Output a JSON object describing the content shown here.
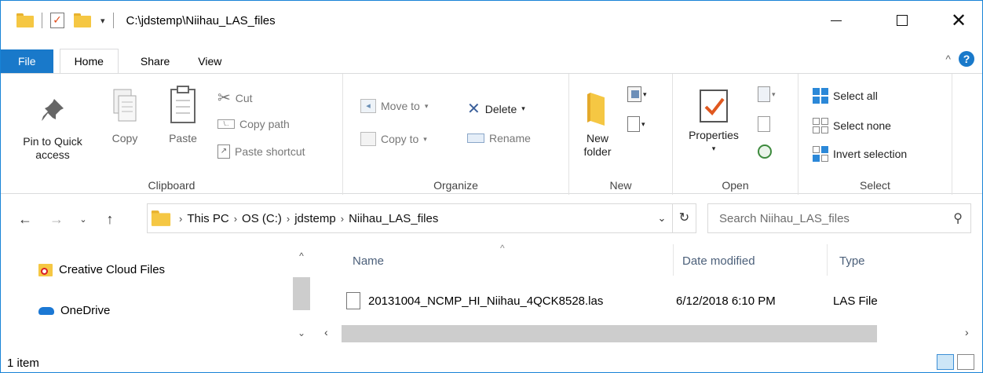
{
  "window": {
    "title": "C:\\jdstemp\\Niihau_LAS_files",
    "controls": {
      "minimize": "minimize",
      "maximize": "maximize",
      "close": "close"
    }
  },
  "quick_access": {
    "dropdown": "▾"
  },
  "tabs": [
    {
      "label": "File"
    },
    {
      "label": "Home"
    },
    {
      "label": "Share"
    },
    {
      "label": "View"
    }
  ],
  "ribbon": {
    "clipboard": {
      "label": "Clipboard",
      "pin_line1": "Pin to Quick",
      "pin_line2": "access",
      "copy": "Copy",
      "paste": "Paste",
      "cut": "Cut",
      "copy_path": "Copy path",
      "paste_shortcut": "Paste shortcut"
    },
    "organize": {
      "label": "Organize",
      "move_to": "Move to",
      "copy_to": "Copy to",
      "delete": "Delete",
      "rename": "Rename"
    },
    "new": {
      "label": "New",
      "new_folder_line1": "New",
      "new_folder_line2": "folder"
    },
    "open": {
      "label": "Open",
      "properties": "Properties"
    },
    "select": {
      "label": "Select",
      "select_all": "Select all",
      "select_none": "Select none",
      "invert_selection": "Invert selection"
    }
  },
  "address": {
    "crumbs": [
      "This PC",
      "OS (C:)",
      "jdstemp",
      "Niihau_LAS_files"
    ],
    "separator": "›"
  },
  "search": {
    "placeholder": "Search Niihau_LAS_files"
  },
  "nav_pane": {
    "items": [
      {
        "label": "Creative Cloud Files"
      },
      {
        "label": "OneDrive"
      }
    ]
  },
  "file_list": {
    "columns": {
      "name": "Name",
      "date": "Date modified",
      "type": "Type"
    },
    "rows": [
      {
        "name": "20131004_NCMP_HI_Niihau_4QCK8528.las",
        "date": "6/12/2018 6:10 PM",
        "type": "LAS File"
      }
    ]
  },
  "status": {
    "count": "1 item"
  },
  "colors": {
    "accent": "#1979ca",
    "folder": "#f5c743"
  }
}
